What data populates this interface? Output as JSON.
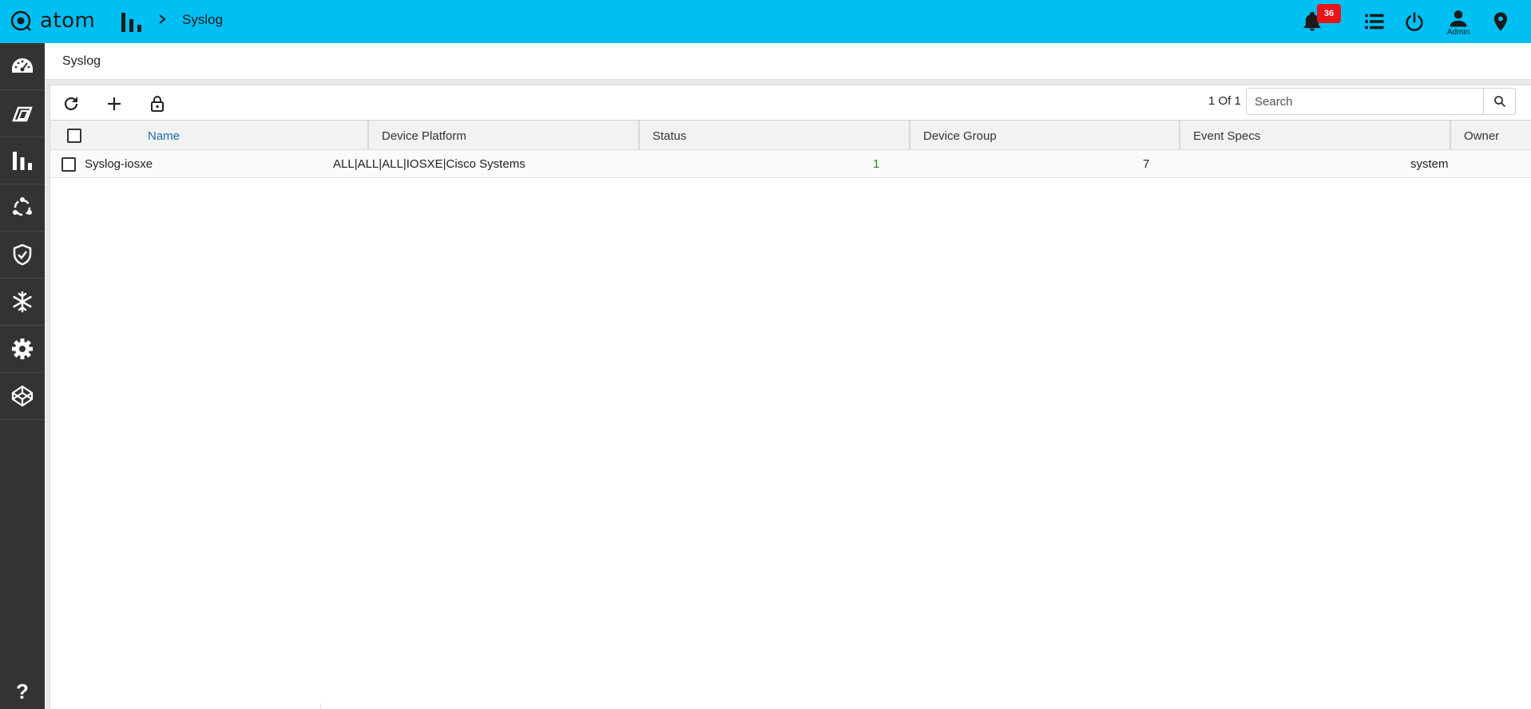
{
  "app": {
    "logo_text": "atom",
    "breadcrumb": "Syslog",
    "notification_count": "36",
    "user_label": "Admin"
  },
  "sidebar": {
    "items": [
      {
        "icon": "dashboard-icon"
      },
      {
        "icon": "devices-icon"
      },
      {
        "icon": "analytics-icon"
      },
      {
        "icon": "network-icon"
      },
      {
        "icon": "shield-check-icon"
      },
      {
        "icon": "snowflake-icon"
      },
      {
        "icon": "gear-icon"
      },
      {
        "icon": "codepen-icon"
      }
    ],
    "help_label": "?"
  },
  "page": {
    "title": "Syslog"
  },
  "toolbar": {
    "pager": "1 Of 1",
    "search_placeholder": "Search"
  },
  "table": {
    "columns": [
      "Name",
      "Device Platform",
      "Status",
      "Device Group",
      "Event Specs",
      "Owner"
    ],
    "rows": [
      {
        "name": "Syslog-iosxe",
        "device_platform": "ALL|ALL|ALL|IOSXE|Cisco Systems",
        "status": "",
        "device_group": "1",
        "event_specs": "7",
        "owner": "system"
      }
    ]
  },
  "colors": {
    "topbar": "#00bff3",
    "sidebar": "#333333",
    "badge": "#e8141a",
    "link": "#2e8b1f",
    "sorted_header": "#1a6fb0"
  }
}
